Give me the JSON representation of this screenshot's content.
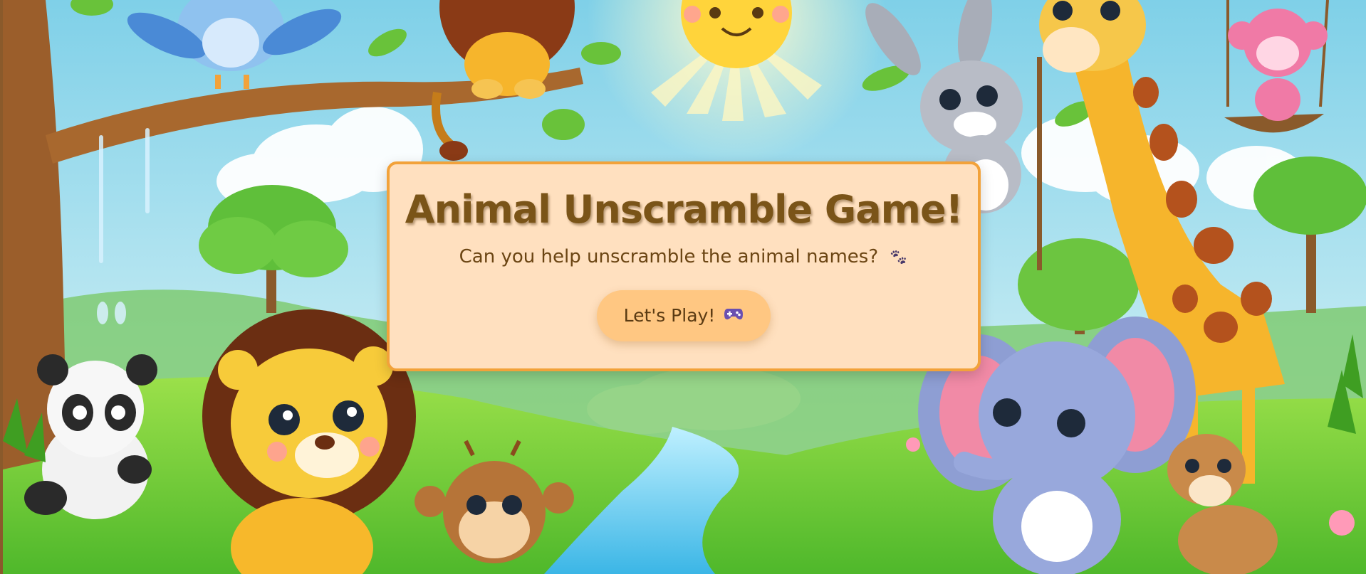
{
  "game": {
    "title": "Animal Unscramble Game!",
    "subtitle": "Can you help unscramble the animal names?",
    "subtitle_icon": "paw-icon",
    "play_button_label": "Let's Play!",
    "play_button_icon": "gamepad-icon"
  },
  "colors": {
    "card_background": "#ffe0bf",
    "card_border": "#f2a23a",
    "title": "#7a5418",
    "text": "#6b4513",
    "button": "#ffc782"
  },
  "background": {
    "scene": "cartoon jungle illustration",
    "animals": [
      "bird",
      "lion",
      "sun",
      "rabbit",
      "giraffe",
      "monkey",
      "panda",
      "lion",
      "monkey",
      "elephant",
      "deer"
    ]
  }
}
